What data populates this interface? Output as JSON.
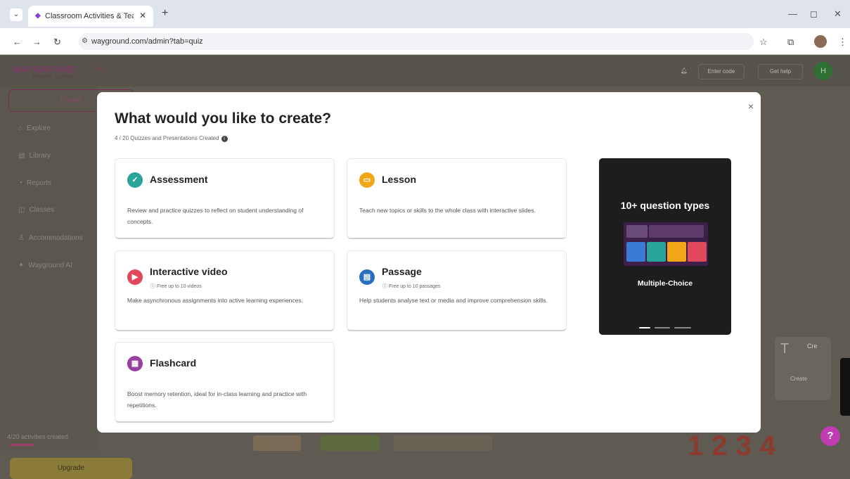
{
  "browser": {
    "tab_title": "Classroom Activities & Teachin",
    "tab_close": "✕",
    "new_tab": "+",
    "url": "wayground.com/admin?tab=quiz"
  },
  "app": {
    "logo": "WAYGROUND",
    "logo_sub": "formerly Quizizz",
    "plan_badge": "Lite",
    "enter_code": "Enter code",
    "get_help": "Get help",
    "avatar_initial": "H",
    "create_label": "Create",
    "sidebar": [
      {
        "label": "Explore"
      },
      {
        "label": "Library"
      },
      {
        "label": "Reports"
      },
      {
        "label": "Classes"
      },
      {
        "label": "Accommodations"
      },
      {
        "label": "Wayground AI"
      }
    ],
    "activities_created": "4/20 activities created",
    "upgrade_label": "Upgrade",
    "bg_numbers": "1234",
    "bg_card_title": "Cre",
    "bg_card_sub": "Crea",
    "bg_card_create": "Create",
    "help": "?"
  },
  "modal": {
    "title": "What would you like to create?",
    "subtitle": "4 / 20 Quizzes and Presentations Created",
    "close": "×",
    "cards": [
      {
        "name": "Assessment",
        "free": "",
        "desc": "Review and practice quizzes to reflect on student understanding of concepts.",
        "color": "#2aa39a"
      },
      {
        "name": "Lesson",
        "free": "",
        "desc": "Teach new topics or skills to the whole class with interactive slides.",
        "color": "#f2a516"
      },
      {
        "name": "Interactive video",
        "free": "Free up to 10 videos",
        "desc": "Make asynchronous assignments into active learning experiences.",
        "color": "#e0495c"
      },
      {
        "name": "Passage",
        "free": "Free up to 10 passages",
        "desc": "Help students analyse text or media and improve comprehension skills.",
        "color": "#2a6ec1"
      },
      {
        "name": "Flashcard",
        "free": "",
        "desc": "Boost memory retention, ideal for in-class learning and practice with repetitions.",
        "color": "#9a3ea0"
      }
    ],
    "promo": {
      "heading": "10+ question types",
      "footer": "Multiple-Choice"
    }
  }
}
